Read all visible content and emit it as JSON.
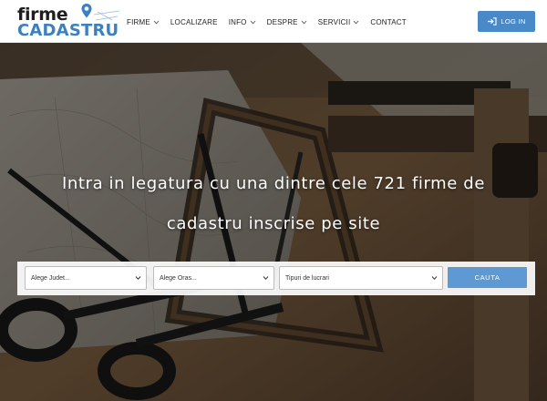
{
  "logo": {
    "line1": "firme",
    "line2": "CADASTRU"
  },
  "nav": {
    "items": [
      {
        "label": "FIRME",
        "dropdown": true
      },
      {
        "label": "LOCALIZARE",
        "dropdown": false
      },
      {
        "label": "INFO",
        "dropdown": true
      },
      {
        "label": "DESPRE",
        "dropdown": true
      },
      {
        "label": "SERVICII",
        "dropdown": true
      },
      {
        "label": "CONTACT",
        "dropdown": false
      }
    ],
    "login_label": "LOG IN"
  },
  "hero": {
    "headline_line1": "Intra in legatura cu una dintre cele 721 firme de",
    "headline_line2": "cadastru inscrise pe site"
  },
  "search": {
    "county_selected": "Alege Judet...",
    "city_selected": "Alege Oras...",
    "work_type_selected": "Tipuri de lucrari",
    "button_label": "CAUTA"
  },
  "colors": {
    "brand_blue": "#3d80bf",
    "login_button": "#4a89c8",
    "search_button": "#5e99d3"
  }
}
